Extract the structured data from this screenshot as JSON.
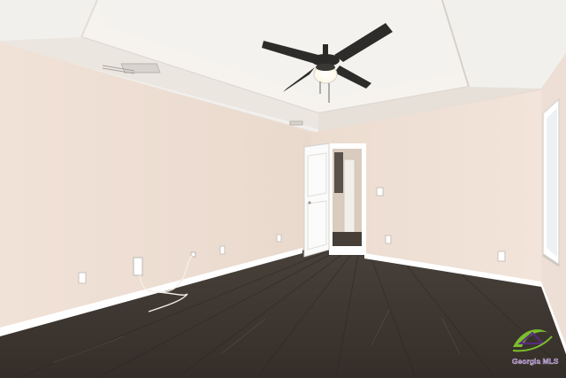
{
  "scene": {
    "description_icon": "room-photo",
    "colors": {
      "wall": "#efe0d6",
      "wall_shadow": "#e2d2c6",
      "ceiling": "#f3f1ee",
      "tray": "#f7f5f2",
      "trim": "#ffffff",
      "floor_dark": "#3b3530",
      "floor_mid": "#4c453e",
      "floor_light": "#5e554c",
      "fan": "#2b2a29",
      "door": "#fbfbfb"
    }
  },
  "watermark": {
    "brand_line": "Georgia MLS",
    "colors": {
      "green": "#7bbf2a",
      "purple": "#5a2a82"
    }
  }
}
